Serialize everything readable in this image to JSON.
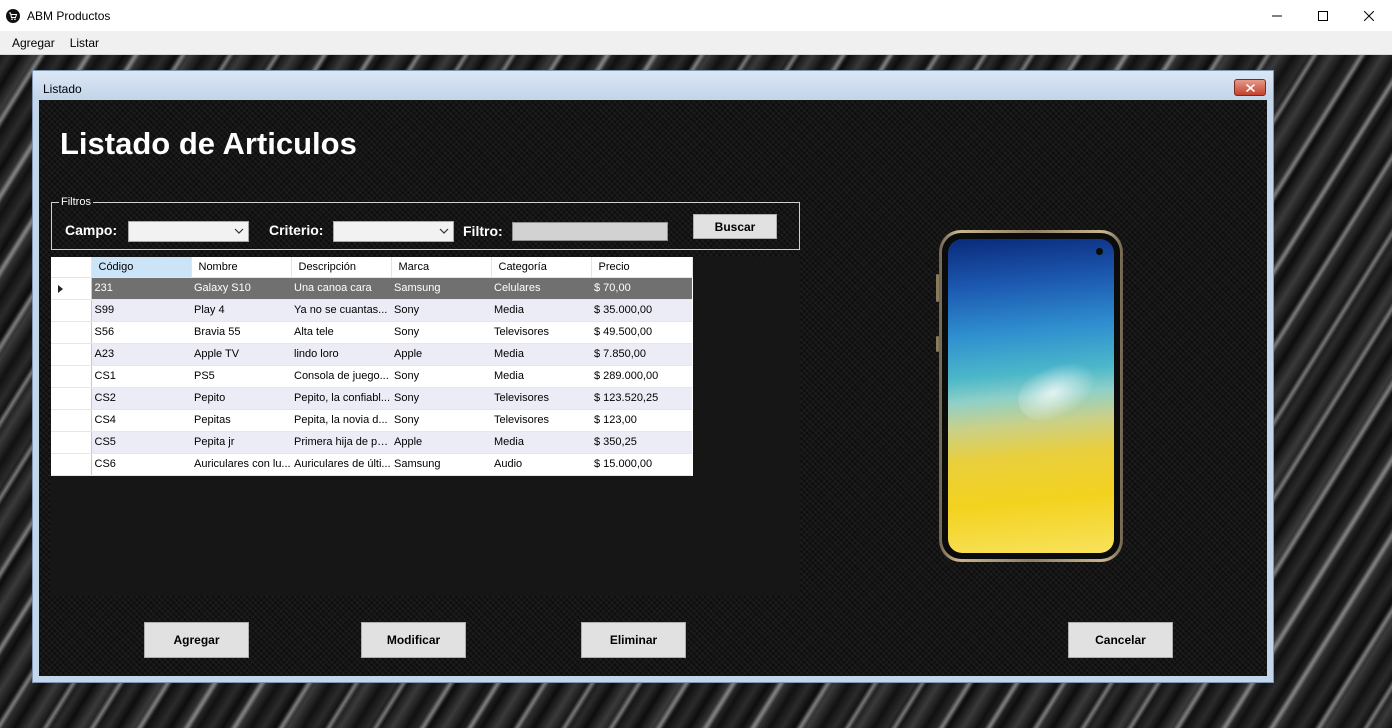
{
  "app": {
    "title": "ABM Productos"
  },
  "menu": {
    "items": [
      "Agregar",
      "Listar"
    ]
  },
  "child": {
    "title": "Listado"
  },
  "page": {
    "heading": "Listado de Articulos"
  },
  "filters": {
    "legend": "Filtros",
    "campo_label": "Campo:",
    "campo_value": "",
    "criterio_label": "Criterio:",
    "criterio_value": "",
    "filtro_label": "Filtro:",
    "filtro_value": "",
    "search_button": "Buscar"
  },
  "grid": {
    "columns": [
      "Código",
      "Nombre",
      "Descripción",
      "Marca",
      "Categoría",
      "Precio"
    ],
    "selected_row": 0,
    "rows": [
      [
        "231",
        "Galaxy S10",
        "Una canoa cara",
        "Samsung",
        "Celulares",
        "$ 70,00"
      ],
      [
        "S99",
        "Play 4",
        "Ya no se cuantas...",
        "Sony",
        "Media",
        "$ 35.000,00"
      ],
      [
        "S56",
        "Bravia 55",
        "Alta tele",
        "Sony",
        "Televisores",
        "$ 49.500,00"
      ],
      [
        "A23",
        "Apple TV",
        "lindo loro",
        "Apple",
        "Media",
        "$ 7.850,00"
      ],
      [
        "CS1",
        "PS5",
        "Consola de juego...",
        "Sony",
        "Media",
        "$ 289.000,00"
      ],
      [
        "CS2",
        "Pepito",
        "Pepito, la confiabl...",
        "Sony",
        "Televisores",
        "$ 123.520,25"
      ],
      [
        "CS4",
        "Pepitas",
        "Pepita, la novia d...",
        "Sony",
        "Televisores",
        "$ 123,00"
      ],
      [
        "CS5",
        "Pepita jr",
        "Primera hija de pe...",
        "Apple",
        "Media",
        "$ 350,25"
      ],
      [
        "CS6",
        "Auriculares con lu...",
        "Auriculares de últi...",
        "Samsung",
        "Audio",
        "$ 15.000,00"
      ]
    ]
  },
  "actions": {
    "add": "Agregar",
    "modify": "Modificar",
    "delete": "Eliminar",
    "cancel": "Cancelar"
  },
  "colors": {
    "selected_row": "#707070",
    "alt_row": "#ececf7",
    "header_selected": "#cce4f7"
  }
}
